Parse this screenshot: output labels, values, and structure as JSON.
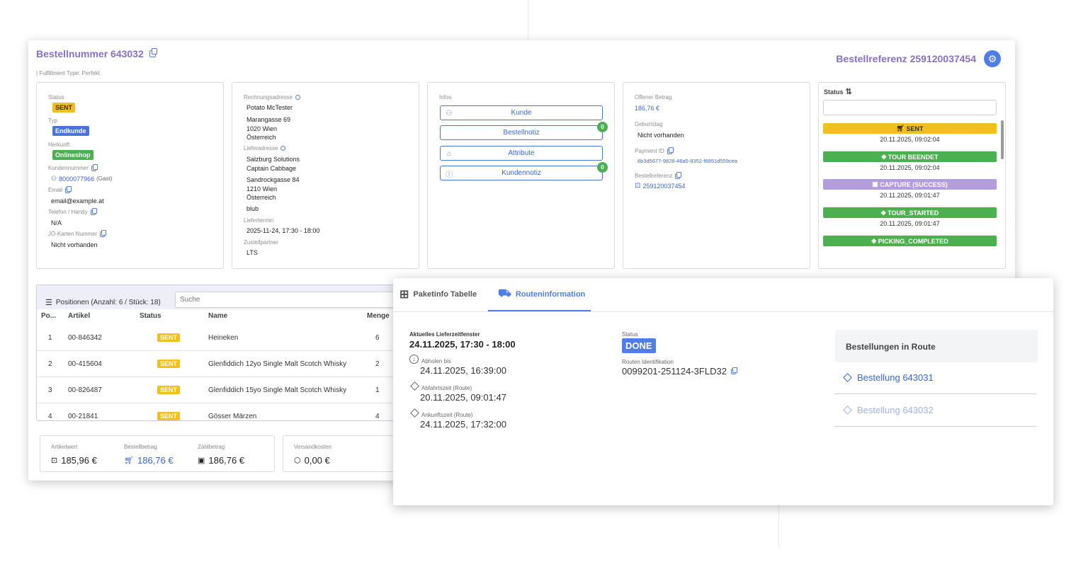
{
  "header": {
    "order_title": "Bestellnummer 643032",
    "fulfillment_type": "| Fulfillment Type: Perfekt",
    "order_reference_title": "Bestellreferenz 259120037454",
    "settings_icon": "gear-icon"
  },
  "customer_panel": {
    "status_label": "Status",
    "status_value": "SENT",
    "type_label": "Typ",
    "type_value": "Endkunde",
    "origin_label": "Herkunft",
    "origin_value": "Onlineshop",
    "customer_number_label": "Kundennummer",
    "customer_number_value": "8000077966",
    "customer_number_note": "(Gast)",
    "email_label": "Email",
    "email_value": "email@example.at",
    "phone_label": "Telefon / Handy",
    "phone_value": "N/A",
    "card_label": "JÖ-Karten Nummer",
    "card_value": "Nicht vorhanden"
  },
  "address_panel": {
    "billing_label": "Rechnungsadresse",
    "billing_lines": [
      "Potato McTester",
      "Marangasse 69",
      "1020 Wien",
      "Österreich"
    ],
    "delivery_label": "Lieferadresse",
    "delivery_lines": [
      "Salzburg Solutions",
      "Captain Cabbage",
      "Sandrockgasse 84",
      "1210 Wien",
      "Österreich",
      "blub"
    ],
    "delivery_date_label": "Liefertermin",
    "delivery_date_value": "2025-11-24, 17:30 - 18:00",
    "partner_label": "Zustellpartner",
    "partner_value": "LTS"
  },
  "infos_panel": {
    "label": "Infos",
    "buttons": [
      {
        "label": "Kunde",
        "icon": "user-icon",
        "count": ""
      },
      {
        "label": "Bestellnotiz",
        "icon": "",
        "count": "0"
      },
      {
        "label": "Attribute",
        "icon": "tag-icon",
        "count": ""
      },
      {
        "label": "Kundennotiz",
        "icon": "info-icon",
        "count": "0"
      }
    ]
  },
  "payment_panel": {
    "open_amount_label": "Offener Betrag",
    "open_amount_value": "186,76 €",
    "birthday_label": "Geburtstag",
    "birthday_value": "Nicht vorhanden",
    "payment_id_label": "Payment ID",
    "payment_id_value": "6b3d5677-9826-46a5-8352-f6951d559cea",
    "order_ref_label": "Bestellreferenz",
    "order_ref_value": "259120037454"
  },
  "status_panel": {
    "label": "Status",
    "sort_icon": "sort-icon",
    "items": [
      {
        "label": "SENT",
        "time": "20.11.2025, 09:02:04",
        "color": "#f0c020"
      },
      {
        "label": "TOUR BEENDET",
        "time": "20.11.2025, 09:02:04",
        "color": "#4caf50"
      },
      {
        "label": "CAPTURE (SUCCESS)",
        "time": "20.11.2025, 09:01:47",
        "color": "#b39ddb"
      },
      {
        "label": "TOUR_STARTED",
        "time": "20.11.2025, 09:01:47",
        "color": "#4caf50"
      },
      {
        "label": "PICKING_COMPLETED",
        "time": "",
        "color": "#4caf50"
      }
    ]
  },
  "positions": {
    "title": "Positionen (Anzahl: 6 / Stück: 18)",
    "search_placeholder": "Suche",
    "columns": [
      "Po...",
      "Artikel",
      "Status",
      "Name",
      "Menge"
    ],
    "rows": [
      {
        "pos": "1",
        "article": "00-846342",
        "status": "SENT",
        "name": "Heineken",
        "qty": "6"
      },
      {
        "pos": "2",
        "article": "00-415604",
        "status": "SENT",
        "name": "Glenfiddich 12yo Single Malt Scotch Whisky",
        "qty": "2"
      },
      {
        "pos": "3",
        "article": "00-826487",
        "status": "SENT",
        "name": "Glenfiddich 15yo Single Malt Scotch Whisky",
        "qty": "1"
      },
      {
        "pos": "4",
        "article": "00-21841",
        "status": "SENT",
        "name": "Gösser Märzen",
        "qty": "4"
      }
    ]
  },
  "totals": {
    "article_value_label": "Artikelwert",
    "article_value": "185,96 €",
    "order_amount_label": "Bestellbetrag",
    "order_amount": "186,76 €",
    "payment_amount_label": "Zahlbetrag",
    "payment_amount": "186,76 €",
    "shipping_label": "Versandkosten",
    "shipping_value": "0,00 €"
  },
  "route_overlay": {
    "tabs": [
      {
        "label": "Paketinfo Tabelle",
        "icon": "gift-icon"
      },
      {
        "label": "Routeninformation",
        "icon": "truck-icon"
      }
    ],
    "window_label": "Aktuelles Lieferzeitfenster",
    "window_value": "24.11.2025, 17:30 - 18:00",
    "pickup_label": "Abholen bis",
    "pickup_value": "24.11.2025, 16:39:00",
    "departure_label": "Abfahrtszeit (Route)",
    "departure_value": "20.11.2025, 09:01:47",
    "arrival_label": "Ankunftszeit (Route)",
    "arrival_value": "24.11.2025, 17:32:00",
    "status_label": "Status",
    "status_value": "DONE",
    "route_id_label": "Routen Identifikation",
    "route_id_value": "0099201-251124-3FLD32",
    "orders_title": "Bestellungen in Route",
    "orders": [
      {
        "label": "Bestellung 643031",
        "color": "#3a67d1"
      },
      {
        "label": "Bestellung 643032",
        "color": "#9fb5e6"
      }
    ]
  }
}
